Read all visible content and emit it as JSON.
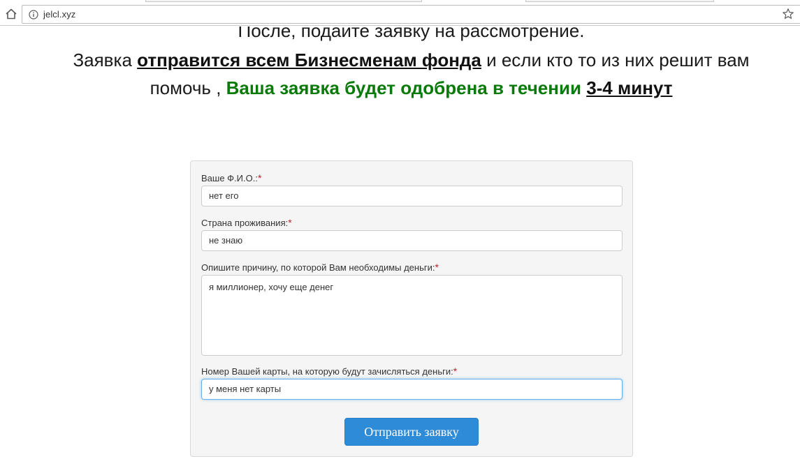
{
  "browser": {
    "url": "jelcl.xyz",
    "icons": {
      "home": "home-icon",
      "info": "info-icon",
      "bookmark": "star-icon"
    }
  },
  "intro": {
    "line1": "После, подайте заявку на рассмотрение.",
    "line2_prefix": "Заявка ",
    "line2_bold": "отправится всем Бизнесменам фонда",
    "line2_suffix": " и если кто то из них решит вам",
    "line3_prefix": "помочь , ",
    "line3_green": "Ваша заявка будет одобрена в течении",
    "line3_space": " ",
    "line3_bold": "3-4 минут"
  },
  "form": {
    "required_mark": "*",
    "name_label": "Ваше Ф.И.О.:",
    "name_value": "нет его",
    "country_label": "Страна проживания:",
    "country_value": "не знаю",
    "reason_label": "Опишите причину, по которой Вам необходимы деньги:",
    "reason_value": "я миллионер, хочу еще денег",
    "card_label": "Номер Вашей карты, на которую будут зачисляться деньги:",
    "card_value": "у меня нет карты",
    "submit_label": "Отправить заявку"
  },
  "colors": {
    "green_text": "#0a7a0a",
    "required": "#c0202a",
    "button": "#2e8bd8",
    "focus_border": "#66afe9"
  }
}
